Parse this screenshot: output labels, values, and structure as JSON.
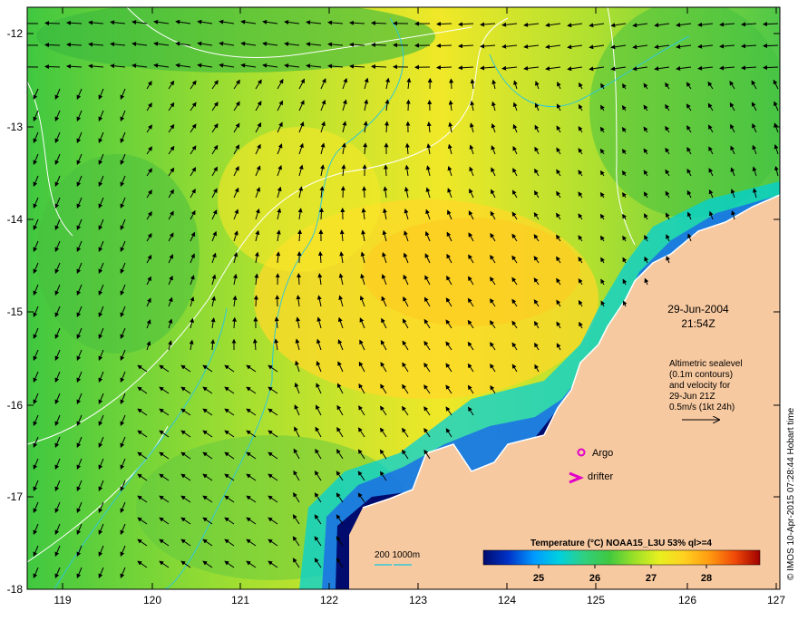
{
  "map": {
    "lon_ticks": [
      "119",
      "120",
      "121",
      "122",
      "123",
      "124",
      "125",
      "126",
      "127"
    ],
    "lat_ticks": [
      "-12",
      "-13",
      "-14",
      "-15",
      "-16",
      "-17",
      "-18"
    ],
    "colors": {
      "land": "#f7c9a0",
      "coast_fill": "#000b6e",
      "contour": "#ffffff",
      "bathy": "#31c8d8"
    }
  },
  "annotation": {
    "date": "29-Jun-2004",
    "time": "21:54Z",
    "info_lines": [
      "Altimetric sealevel",
      "(0.1m contours)",
      "and velocity for",
      "29-Jun 21Z",
      "0.5m/s (1kt 24h)"
    ]
  },
  "markers": {
    "argo_label": "Argo",
    "argo_color": "#e000c8",
    "drifter_label": "drifter",
    "drifter_color": "#e000c8"
  },
  "bathymetry_legend": {
    "label": "200  1000m"
  },
  "colorbar": {
    "title": "Temperature (°C) NOAA15_L3U 53% ql>=4",
    "ticks": [
      "25",
      "26",
      "27",
      "28"
    ],
    "stops": [
      "#000b6e",
      "#0033c8",
      "#0099ff",
      "#00d0e0",
      "#30d080",
      "#40c840",
      "#9ae028",
      "#e8f020",
      "#ffd020",
      "#ff9a10",
      "#f04a08",
      "#a00000"
    ]
  },
  "credit": "© IMOS 10-Apr-2015 07:28:44 Hobart time"
}
